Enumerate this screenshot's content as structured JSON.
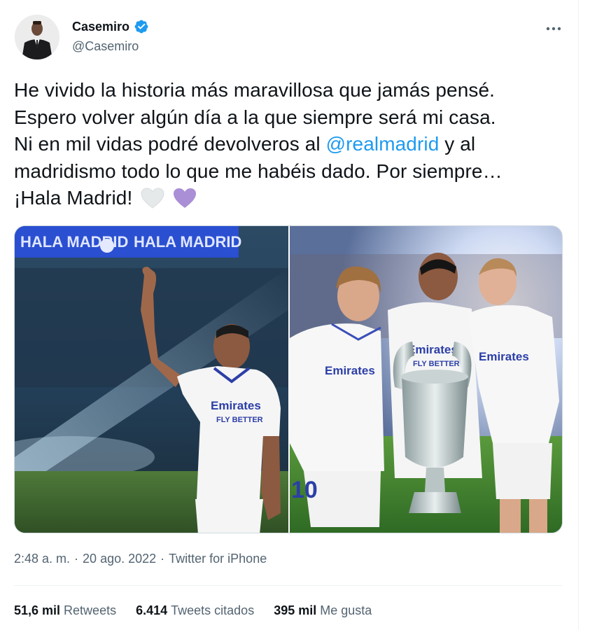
{
  "author": {
    "name": "Casemiro",
    "handle": "@Casemiro",
    "verified_color": "#1d9bf0"
  },
  "tweet": {
    "line1": "He vivido la historia más maravillosa que jamás pensé.",
    "line2": "Espero volver algún día a la que siempre será mi casa.",
    "line3_pre": "Ni en mil vidas podré devolveros al ",
    "mention": "@realmadrid",
    "line3_post": " y al",
    "line4": "madridismo todo lo que me habéis dado. Por siempre…",
    "line5": "¡Hala Madrid!",
    "emojis": [
      "white-heart-icon",
      "purple-heart-icon"
    ]
  },
  "media": {
    "photos": [
      "casemiro-waving-stadium",
      "modric-casemiro-kroos-with-trophy"
    ],
    "banner_text_1": "HALA MADRID",
    "banner_text_2": "HALA MADRID",
    "jersey_sponsor": "Emirates",
    "jersey_sub": "FLY BETTER",
    "jersey_number": "10"
  },
  "meta": {
    "time": "2:48 a. m.",
    "dot1": "·",
    "date": "20 ago. 2022",
    "dot2": "·",
    "source": "Twitter for iPhone"
  },
  "stats": [
    {
      "num": "51,6 mil",
      "label": "Retweets"
    },
    {
      "num": "6.414",
      "label": "Tweets citados"
    },
    {
      "num": "395 mil",
      "label": "Me gusta"
    }
  ]
}
